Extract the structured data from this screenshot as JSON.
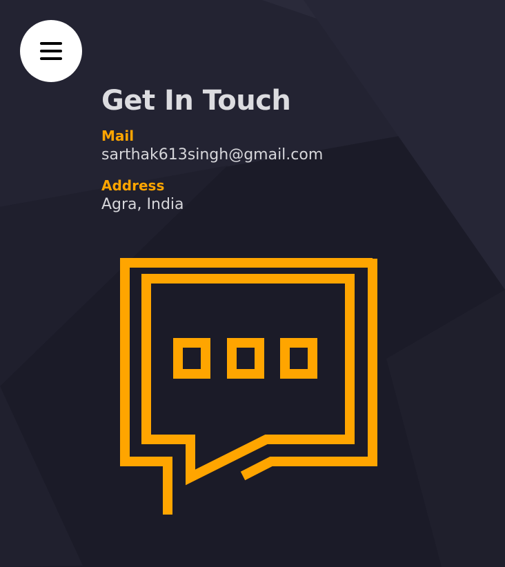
{
  "menu": {
    "icon": "hamburger-icon"
  },
  "contact": {
    "title": "Get In Touch",
    "mail_label": "Mail",
    "mail_value": "sarthak613singh@gmail.com",
    "address_label": "Address",
    "address_value": "Agra, India"
  },
  "illustration": {
    "icon": "chat-bubble-icon"
  },
  "colors": {
    "background": "#1b1b28",
    "accent": "#ffa500",
    "title": "#dcdce0",
    "text": "#d6d6da",
    "menu_button": "#ffffff"
  }
}
